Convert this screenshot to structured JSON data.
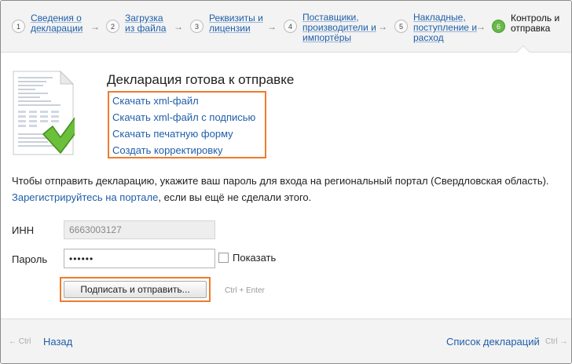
{
  "steps": [
    {
      "num": "1",
      "label_line1": "Сведения о",
      "label_line2": "декларации"
    },
    {
      "num": "2",
      "label_line1": "Загрузка",
      "label_line2": "из файла"
    },
    {
      "num": "3",
      "label_line1": "Реквизиты и",
      "label_line2": "лицензии"
    },
    {
      "num": "4",
      "label_line1": "Поставщики,",
      "label_line2": "производители и",
      "label_line3": "импортёры"
    },
    {
      "num": "5",
      "label_line1": "Накладные,",
      "label_line2": "поступление и",
      "label_line3": "расход"
    },
    {
      "num": "6",
      "label_line1": "Контроль и",
      "label_line2": "отправка"
    }
  ],
  "step_arrow": "→",
  "title": "Декларация готова к отправке",
  "links": {
    "download_xml": "Скачать xml-файл",
    "download_xml_signed": "Скачать xml-файл с подписью",
    "download_print": "Скачать печатную форму",
    "create_correction": "Создать корректировку"
  },
  "info": {
    "text1": "Чтобы отправить декларацию, укажите ваш пароль для входа на региональный портал (Свердловская область).",
    "register_link": "Зарегистрируйтесь на портале",
    "text2": ", если вы ещё не сделали этого."
  },
  "form": {
    "inn_label": "ИНН",
    "inn_value": "6663003127",
    "password_label": "Пароль",
    "password_value": "••••••",
    "show_label": "Показать",
    "submit_label": "Подписать и отправить...",
    "submit_hint": "Ctrl + Enter"
  },
  "footer": {
    "back_hint": "← Ctrl",
    "back_label": "Назад",
    "list_label": "Список деклараций",
    "forward_hint": "Ctrl →"
  },
  "colors": {
    "link": "#1f5ea8",
    "highlight": "#ef7b2c",
    "active_step": "#68b84a"
  }
}
